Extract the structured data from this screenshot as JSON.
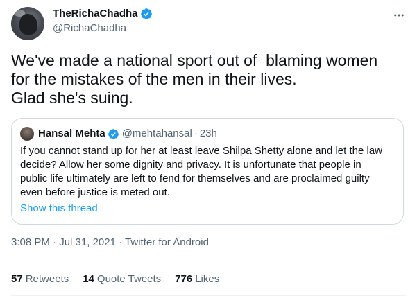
{
  "author": {
    "display_name": "TheRichaChadha",
    "handle": "@RichaChadha",
    "verified": true
  },
  "tweet": {
    "text": "We've made a national sport out of  blaming women\nfor the mistakes of the men in their lives.\nGlad she's suing."
  },
  "quoted_tweet": {
    "display_name": "Hansal Mehta",
    "handle": "@mehtahansal",
    "separator": "·",
    "time": "23h",
    "text": "If you cannot stand up for her at least leave Shilpa Shetty alone and let the law decide? Allow her some dignity and privacy. It is unfortunate that people in public life ultimately are left to fend for themselves and are proclaimed guilty even before justice is meted out.",
    "show_thread_label": "Show this thread"
  },
  "meta": {
    "time": "3:08 PM",
    "separator": "·",
    "date": "Jul 31, 2021",
    "source": "Twitter for Android"
  },
  "stats": {
    "retweets_count": "57",
    "retweets_label": "Retweets",
    "quote_tweets_count": "14",
    "quote_tweets_label": "Quote Tweets",
    "likes_count": "776",
    "likes_label": "Likes"
  },
  "colors": {
    "accent": "#1d9bf0",
    "text": "#0f1419",
    "secondary": "#536471",
    "border": "#cfd9de"
  },
  "icons": {
    "verified": "verified-badge-icon",
    "more": "more-horizontal-icon"
  }
}
